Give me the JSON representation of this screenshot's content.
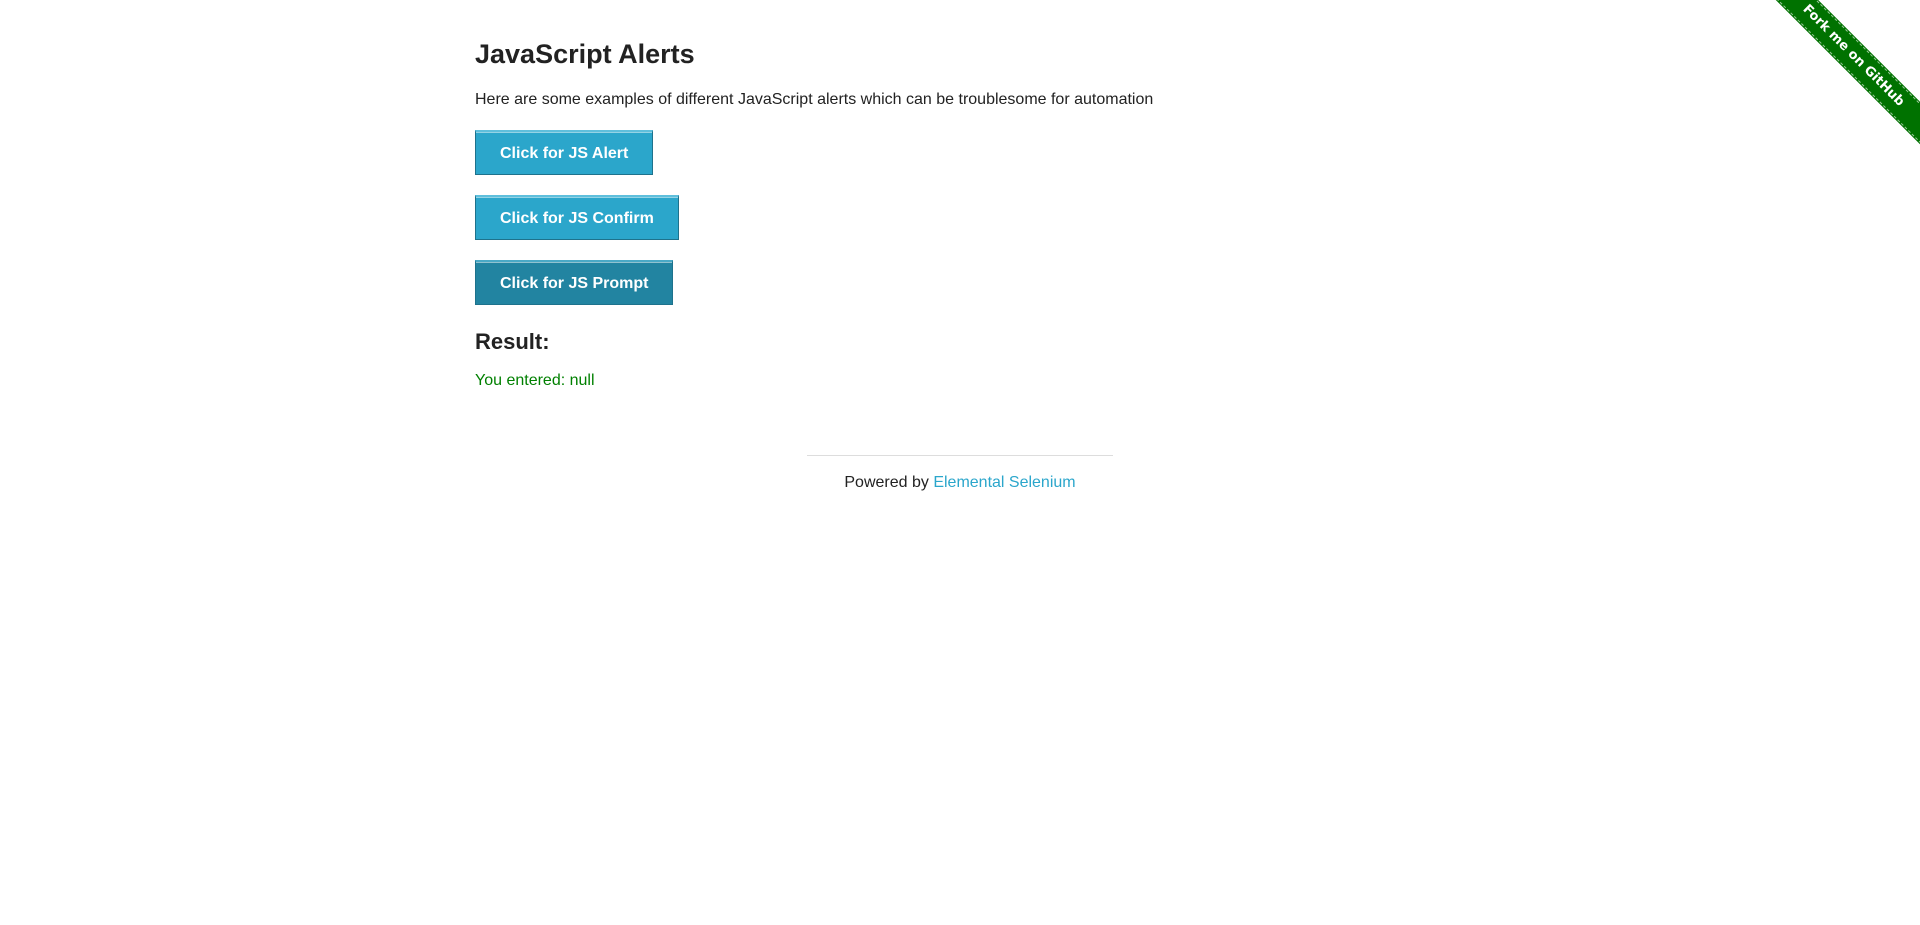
{
  "ribbon": {
    "label": "Fork me on GitHub",
    "color": "#007200"
  },
  "page": {
    "title": "JavaScript Alerts",
    "intro": "Here are some examples of different JavaScript alerts which can be troublesome for automation"
  },
  "buttons": [
    {
      "label": "Click for JS Alert"
    },
    {
      "label": "Click for JS Confirm"
    },
    {
      "label": "Click for JS Prompt"
    }
  ],
  "result": {
    "heading": "Result:",
    "text": "You entered: null",
    "color": "#008000"
  },
  "footer": {
    "prefix": "Powered by",
    "link_label": "Elemental Selenium",
    "link_color": "#2ba6cb"
  },
  "accent_color": "#2ba6cb"
}
